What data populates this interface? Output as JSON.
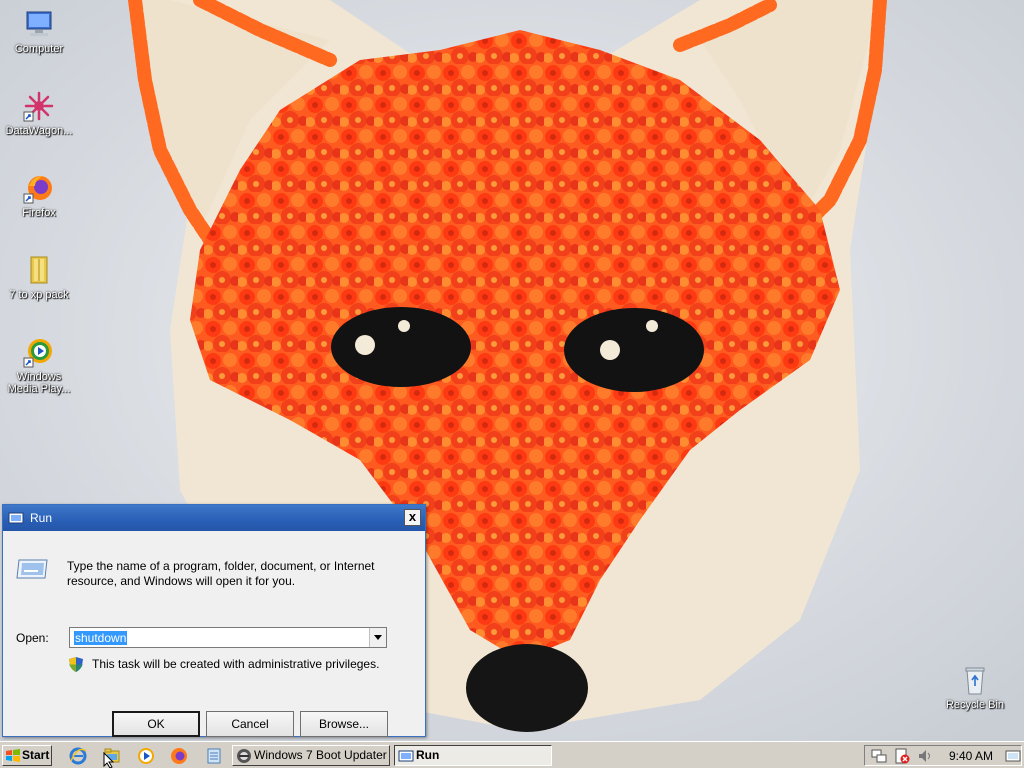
{
  "desktop": {
    "icons": [
      {
        "label": "Computer",
        "icon": "computer-icon"
      },
      {
        "label": "DataWagon...",
        "icon": "datawagon-icon"
      },
      {
        "label": "Firefox",
        "icon": "firefox-icon"
      },
      {
        "label": "7 to xp pack",
        "icon": "folder-icon"
      },
      {
        "label": "Windows Media Play...",
        "icon": "media-player-icon"
      },
      {
        "label": "Recycle Bin",
        "icon": "recycle-bin-icon"
      }
    ]
  },
  "run_dialog": {
    "title": "Run",
    "description": "Type the name of a program, folder, document, or Internet resource, and Windows will open it for you.",
    "open_label": "Open:",
    "open_value": "shutdown",
    "admin_note": "This task will be created with administrative privileges.",
    "ok_label": "OK",
    "cancel_label": "Cancel",
    "browse_label": "Browse...",
    "close_glyph": "x"
  },
  "taskbar": {
    "start_label": "Start",
    "quick_launch": [
      "ie-icon",
      "explorer-icon",
      "media-player-icon",
      "firefox-icon",
      "notepad-icon"
    ],
    "tasks": [
      {
        "label": "Windows 7 Boot Updater",
        "active": false
      },
      {
        "label": "Run",
        "active": true
      }
    ],
    "clock": "9:40 AM"
  },
  "colors": {
    "titlebar": "#2a5fb6",
    "taskbar": "#d4d0c8",
    "selection": "#3399ff",
    "fox_orange": "#ff5a1f",
    "cake_cream": "#f1e6d3"
  }
}
